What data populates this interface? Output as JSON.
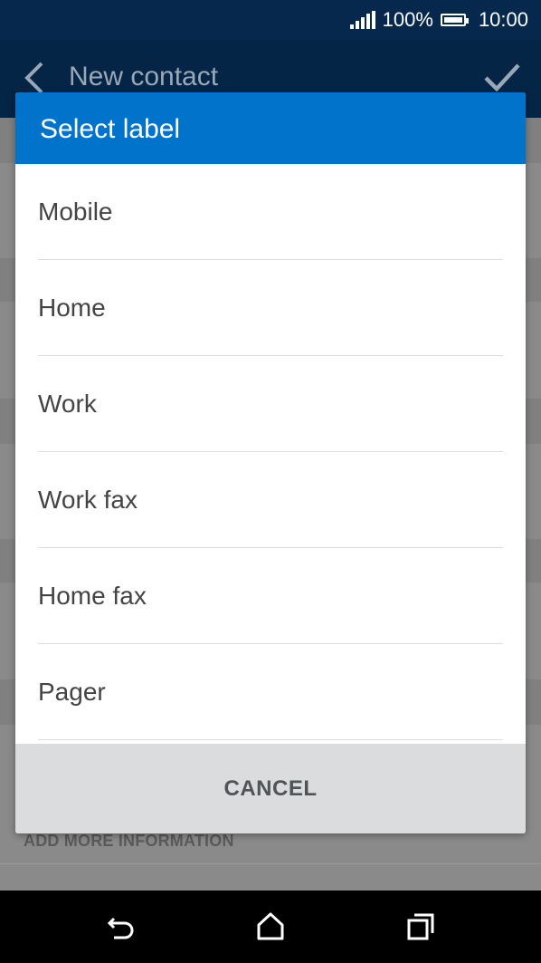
{
  "status_bar": {
    "battery_percent": "100%",
    "time": "10:00"
  },
  "app_bar": {
    "title": "New contact"
  },
  "page": {
    "add_more_info": "ADD MORE INFORMATION"
  },
  "dialog": {
    "title": "Select label",
    "options": [
      "Mobile",
      "Home",
      "Work",
      "Work fax",
      "Home fax",
      "Pager"
    ],
    "cancel_label": "CANCEL"
  },
  "colors": {
    "dialog_header": "#0273cb",
    "status_bar": "#07284d",
    "footer": "#dadcdd"
  }
}
